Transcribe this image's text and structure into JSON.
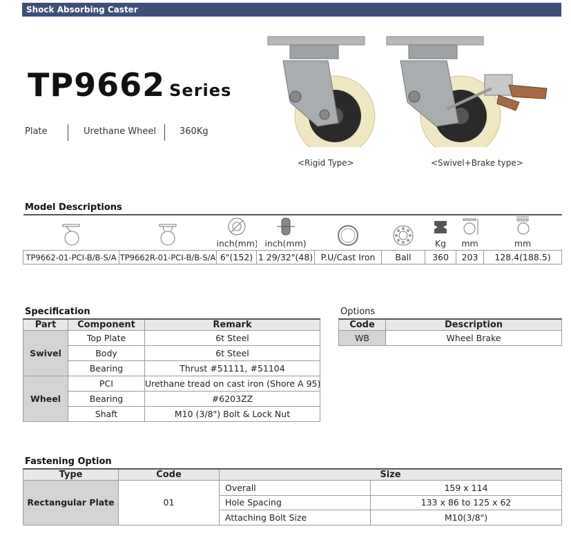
{
  "header": {
    "title": "Shock Absorbing Caster"
  },
  "product": {
    "model": "TP9662",
    "series": "Series"
  },
  "specs": {
    "plate": "Plate",
    "wheel": "Urethane Wheel",
    "load": "360Kg"
  },
  "images": {
    "rigid_caption": "<Rigid Type>",
    "swivel_caption": "<Swivel+Brake type>"
  },
  "model_descriptions": {
    "title": "Model Descriptions",
    "icon_units": [
      "",
      "",
      "inch(mm)",
      "inch(mm)",
      "",
      "",
      "Kg",
      "mm",
      "mm"
    ],
    "values": [
      "TP9662-01-PCI-B/B-S/A",
      "TP9662R-01-PCI-B/B-S/A",
      "6\"(152)",
      "1 29/32\"(48)",
      "P.U/Cast Iron",
      "Ball",
      "360",
      "203",
      "128.4(188.5)"
    ]
  },
  "specification": {
    "title": "Specification",
    "headers": [
      "Part",
      "Component",
      "Remark"
    ],
    "groups": [
      {
        "part": "Swivel",
        "rows": [
          {
            "component": "Top Plate",
            "remark": "6t Steel"
          },
          {
            "component": "Body",
            "remark": "6t Steel"
          },
          {
            "component": "Bearing",
            "remark": "Thrust #51111, #51104"
          }
        ]
      },
      {
        "part": "Wheel",
        "rows": [
          {
            "component": "PCI",
            "remark": "Urethane tread on cast iron (Shore A 95)"
          },
          {
            "component": "Bearing",
            "remark": "#6203ZZ"
          },
          {
            "component": "Shaft",
            "remark": "M10 (3/8\") Bolt & Lock Nut"
          }
        ]
      }
    ]
  },
  "options": {
    "title": "Options",
    "headers": [
      "Code",
      "Description"
    ],
    "rows": [
      {
        "code": "WB",
        "description": "Wheel Brake"
      }
    ]
  },
  "fastening": {
    "title": "Fastening Option",
    "headers": [
      "Type",
      "Code",
      "Size"
    ],
    "type": "Rectangular Plate",
    "code": "01",
    "rows": [
      {
        "label": "Overall",
        "value": "159 x 114"
      },
      {
        "label": "Hole Spacing",
        "value": "133 x 86 to 125 x 62"
      },
      {
        "label": "Attaching Bolt Size",
        "value": "M10(3/8\")"
      }
    ]
  }
}
